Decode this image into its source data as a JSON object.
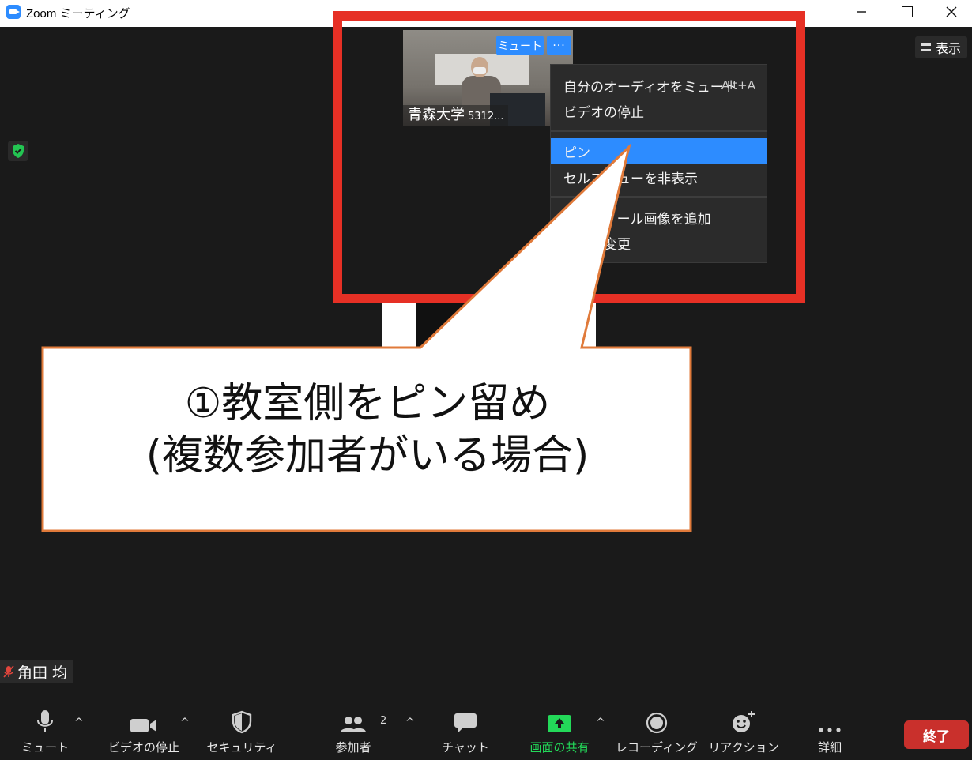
{
  "window": {
    "title": "Zoom ミーティング",
    "controls": [
      "minimize",
      "maximize",
      "close"
    ]
  },
  "view_button": {
    "label": "表示"
  },
  "video_tile": {
    "name": "青森大学",
    "id_suffix": "5312...",
    "mute_label": "ミュート",
    "more_label": "···"
  },
  "context_menu": {
    "items": [
      {
        "label": "自分のオーディオをミュート",
        "shortcut": "Alt+A"
      },
      {
        "label": "ビデオの停止",
        "shortcut": ""
      },
      {
        "label": "ピン",
        "shortcut": "",
        "active": true
      },
      {
        "label": "セルフビューを非表示",
        "shortcut": ""
      },
      {
        "label": "プロフィール画像を追加",
        "shortcut": ""
      },
      {
        "label": "名前の変更",
        "shortcut": ""
      }
    ]
  },
  "callout": {
    "line1": "①教室側をピン留め",
    "line2": "(複数参加者がいる場合)"
  },
  "self_label": {
    "name": "角田 均"
  },
  "toolbar": {
    "mute": "ミュート",
    "video_stop": "ビデオの停止",
    "security": "セキュリティ",
    "participants": "参加者",
    "participants_count": "2",
    "chat": "チャット",
    "share": "画面の共有",
    "record": "レコーディング",
    "reactions": "リアクション",
    "more": "詳細",
    "end": "終了"
  },
  "colors": {
    "accent_blue": "#2d8cff",
    "highlight_red": "#e63025",
    "callout_border": "#e07a3a",
    "share_green": "#23d959",
    "end_red": "#c9302c"
  }
}
